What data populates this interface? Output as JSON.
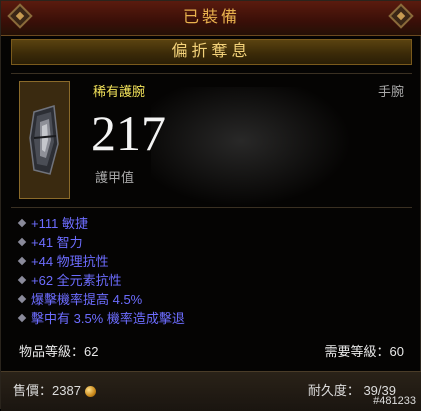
{
  "header": {
    "title": "已裝備"
  },
  "item": {
    "name": "偏折奪息",
    "rarity": "稀有護腕",
    "slot": "手腕",
    "armor_value": "217",
    "armor_label": "護甲值",
    "image_icon": "bracer-icon",
    "stats": [
      "+111 敏捷",
      "+41 智力",
      "+44 物理抗性",
      "+62 全元素抗性",
      "爆擊機率提高 4.5%",
      "擊中有 3.5% 機率造成擊退"
    ],
    "item_level": "物品等級：62",
    "required_level": "需要等級：60"
  },
  "footer": {
    "price": "售價：2387",
    "durability": "耐久度： 39/39",
    "watermark": "#481233"
  },
  "colors": {
    "stat_blue": "#6d6dff",
    "rarity_yellow": "#f2e25a",
    "name_gold": "#f3d27a",
    "header_orange": "#e9b24e"
  }
}
